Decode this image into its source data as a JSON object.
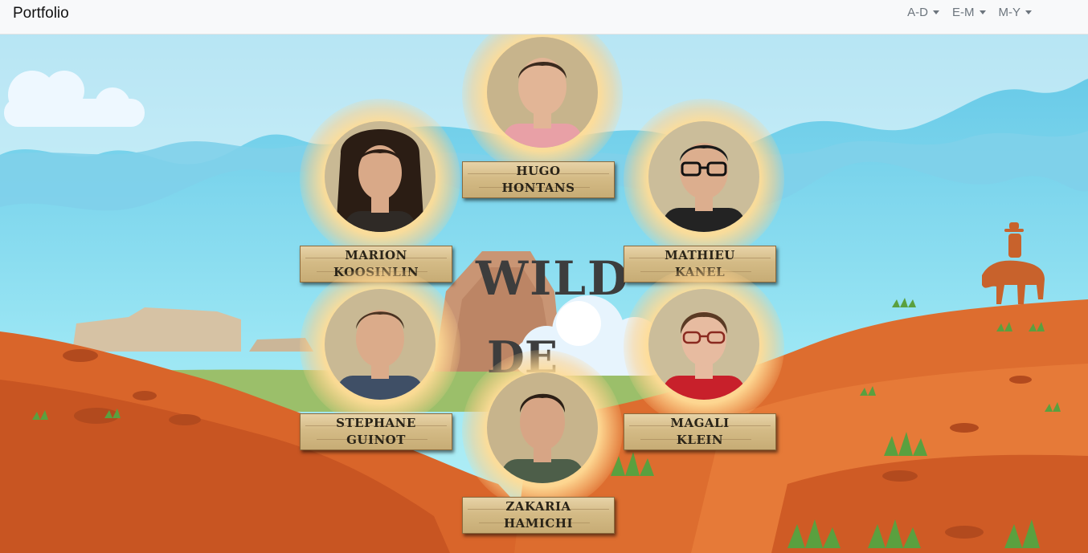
{
  "navbar": {
    "brand": "Portfolio",
    "menus": [
      "A-D",
      "E-M",
      "M-Y"
    ]
  },
  "title": {
    "line1": "WILD",
    "line2": "DE"
  },
  "members": [
    {
      "first": "HUGO",
      "last": "HONTANS",
      "shirt": "#e8a0a6",
      "hair": "#3b2a1e",
      "skin": "#e2b596"
    },
    {
      "first": "MARION",
      "last": "KOOSINLIN",
      "shirt": "#2f2a26",
      "hair": "#2b1d14",
      "skin": "#d9a988"
    },
    {
      "first": "MATHIEU",
      "last": "KANEL",
      "shirt": "#232323",
      "hair": "#1b1b1b",
      "skin": "#dcae8e"
    },
    {
      "first": "STEPHANE",
      "last": "GUINOT",
      "shirt": "#3f4f66",
      "hair": "#4a3322",
      "skin": "#dbab8a"
    },
    {
      "first": "MAGALI",
      "last": "KLEIN",
      "shirt": "#c8202b",
      "hair": "#5a3a24",
      "skin": "#e7bba0"
    },
    {
      "first": "ZAKARIA",
      "last": "HAMICHI",
      "shirt": "#4d5e49",
      "hair": "#2c1f16",
      "skin": "#d7a585"
    }
  ],
  "colors": {
    "sky": "#8fe0f2",
    "desert": "#d9652a",
    "mesa": "#c9a98a"
  }
}
